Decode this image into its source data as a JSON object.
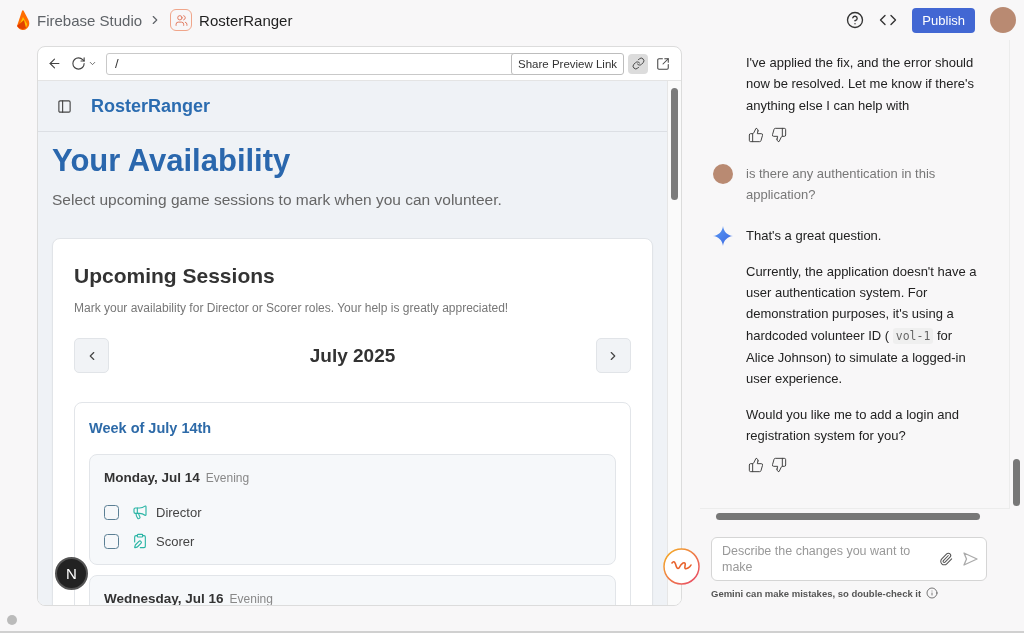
{
  "top_bar": {
    "product": "Firebase Studio",
    "project": "RosterRanger",
    "publish": "Publish"
  },
  "preview": {
    "url": "/",
    "tooltip": "Share Preview Link",
    "share_link_highlighted": true,
    "dev_badge": "N",
    "app": {
      "brand": "RosterRanger",
      "title": "Your Availability",
      "subtitle": "Select upcoming game sessions to mark when you can volunteer.",
      "card": {
        "title": "Upcoming Sessions",
        "description": "Mark your availability for Director or Scorer roles. Your help is greatly appreciated!",
        "month": "July 2025",
        "weeks": [
          {
            "label": "Week of July 14th",
            "days": [
              {
                "date": "Monday, Jul 14",
                "time": "Evening",
                "roles": [
                  {
                    "kind": "director",
                    "label": "Director",
                    "checked": false
                  },
                  {
                    "kind": "scorer",
                    "label": "Scorer",
                    "checked": false
                  }
                ]
              },
              {
                "date": "Wednesday, Jul 16",
                "time": "Evening"
              }
            ]
          }
        ]
      }
    }
  },
  "chat": {
    "messages": [
      {
        "kind": "assistant",
        "avatar_visible": false,
        "paragraphs": [
          [
            {
              "kind": "text",
              "text": "I've applied the fix, and the error should now be resolved. Let me know if there's anything else I can help with"
            }
          ]
        ]
      },
      {
        "kind": "user",
        "avatar_visible": true,
        "paragraphs": [
          [
            {
              "kind": "text",
              "text": "is there any authentication in this application?"
            }
          ]
        ]
      },
      {
        "kind": "assistant",
        "avatar_visible": true,
        "paragraphs": [
          [
            {
              "kind": "text",
              "text": "That's a great question."
            }
          ],
          [
            {
              "kind": "text",
              "text": "Currently, the application doesn't have a user authentication system. For demonstration purposes, it's using a hardcoded volunteer ID ( "
            },
            {
              "kind": "code",
              "text": "vol-1"
            },
            {
              "kind": "text",
              "text": " for Alice Johnson) to simulate a logged-in user experience."
            }
          ],
          [
            {
              "kind": "text",
              "text": "Would you like me to add a login and registration system for you?"
            }
          ]
        ]
      }
    ],
    "composer": {
      "placeholder": "Describe the changes you want to make"
    },
    "disclaimer": "Gemini can make mistakes, so double-check it"
  }
}
